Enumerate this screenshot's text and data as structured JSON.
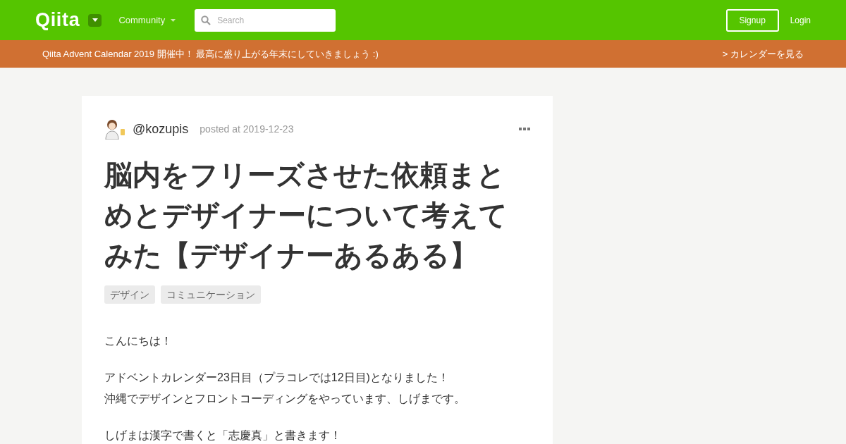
{
  "header": {
    "logo": "Qiita",
    "community": "Community",
    "search": {
      "placeholder": "Search"
    },
    "signup": "Signup",
    "login": "Login"
  },
  "banner": {
    "message": "Qiita Advent Calendar 2019 開催中！ 最高に盛り上がる年末にしていきましょう :)",
    "link": "> カレンダーを見る"
  },
  "article": {
    "author": "@kozupis",
    "posted": "posted at 2019-12-23",
    "title": "脳内をフリーズさせた依頼まとめとデザイナーについて考えてみた【デザイナーあるある】",
    "tags": [
      "デザイン",
      "コミュニケーション"
    ],
    "paragraphs": [
      [
        "こんにちは！"
      ],
      [
        "アドベントカレンダー23日目（プラコレでは12日目)となりました！",
        "沖縄でデザインとフロントコーディングをやっています、しげまです。"
      ],
      [
        "しげまは漢字で書くと「志慶真」と書きます！"
      ]
    ]
  }
}
